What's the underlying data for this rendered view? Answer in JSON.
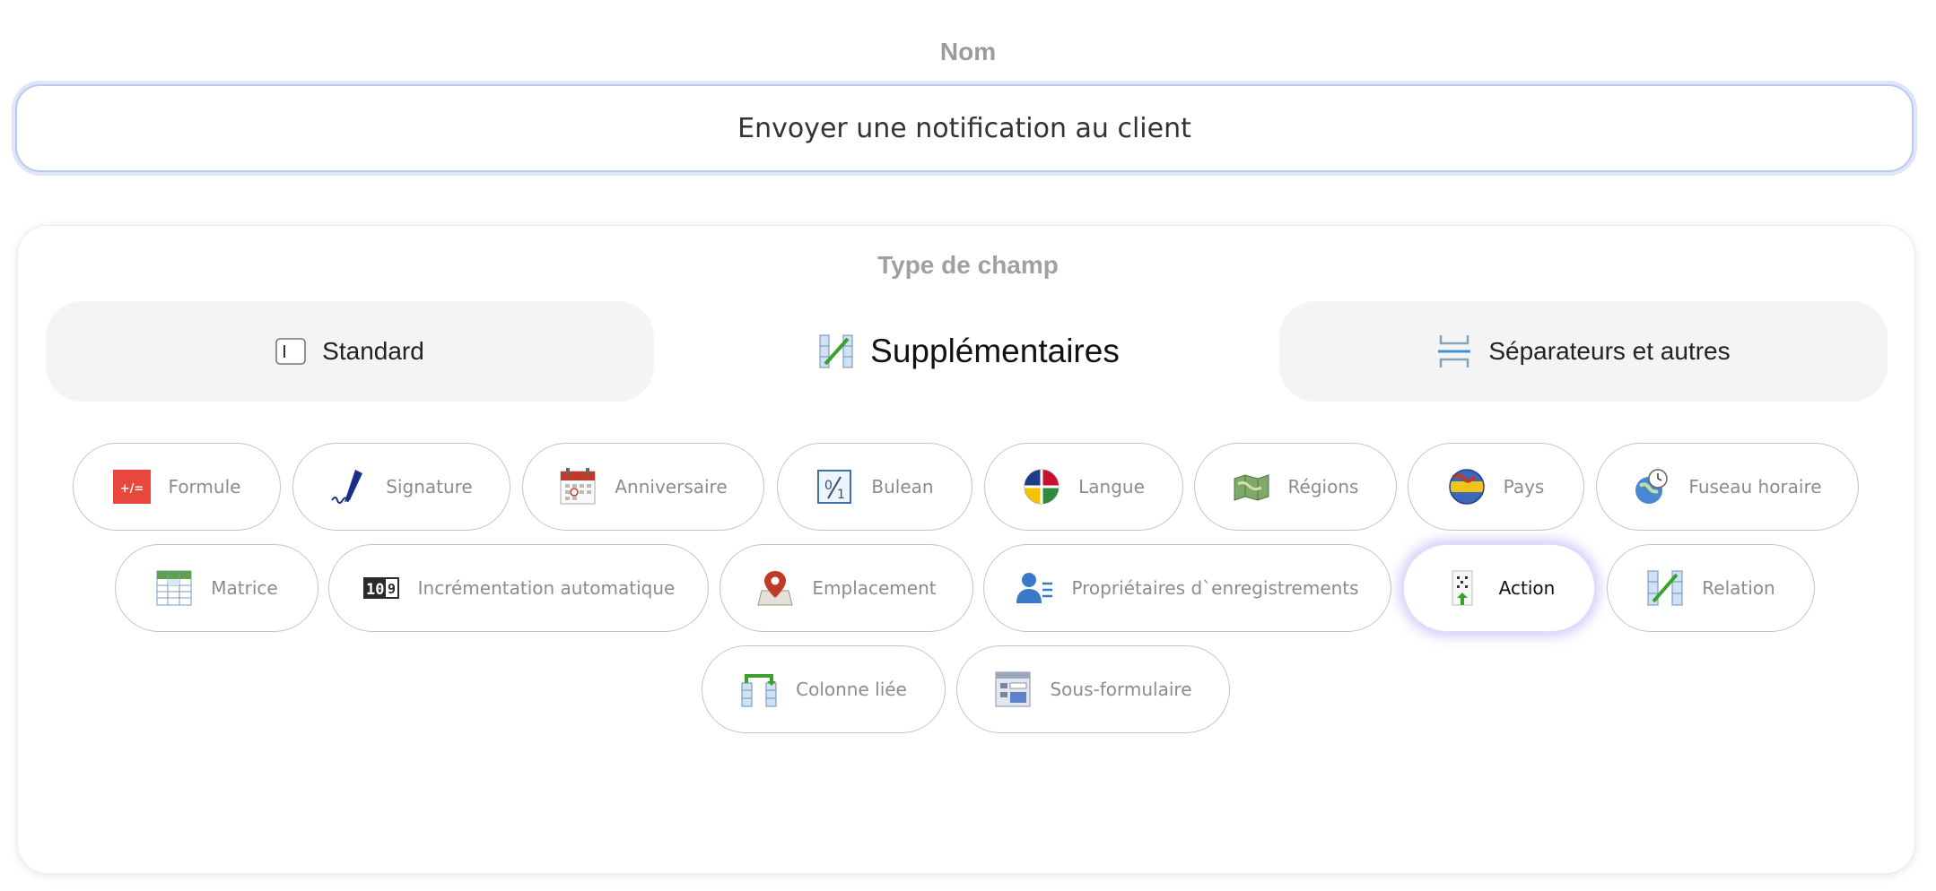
{
  "name_field": {
    "label": "Nom",
    "value": "Envoyer une notification au client"
  },
  "field_type": {
    "title": "Type de champ",
    "tabs": [
      {
        "label": "Standard",
        "icon": "text-field-icon",
        "active": false
      },
      {
        "label": "Supplémentaires",
        "icon": "relation-chart-icon",
        "active": true
      },
      {
        "label": "Séparateurs et autres",
        "icon": "separator-icon",
        "active": false
      }
    ],
    "types": [
      {
        "label": "Formule",
        "icon": "formula-icon"
      },
      {
        "label": "Signature",
        "icon": "signature-pen-icon"
      },
      {
        "label": "Anniversaire",
        "icon": "calendar-icon"
      },
      {
        "label": "Bulean",
        "icon": "boolean-icon"
      },
      {
        "label": "Langue",
        "icon": "language-flags-icon"
      },
      {
        "label": "Régions",
        "icon": "regions-map-icon"
      },
      {
        "label": "Pays",
        "icon": "country-globe-icon"
      },
      {
        "label": "Fuseau horaire",
        "icon": "timezone-globe-icon"
      },
      {
        "label": "Matrice",
        "icon": "matrix-table-icon"
      },
      {
        "label": "Incrémentation automatique",
        "icon": "counter-icon"
      },
      {
        "label": "Emplacement",
        "icon": "location-pin-icon"
      },
      {
        "label": "Propriétaires d`enregistrements",
        "icon": "owner-user-icon"
      },
      {
        "label": "Action",
        "icon": "action-icon",
        "selected": true
      },
      {
        "label": "Relation",
        "icon": "relation-icon"
      },
      {
        "label": "Colonne liée",
        "icon": "linked-column-icon"
      },
      {
        "label": "Sous-formulaire",
        "icon": "subform-icon"
      }
    ]
  },
  "colors": {
    "input_border": "#bcc8f0",
    "selected_glow": "#786eeb",
    "formula_red": "#e8473d"
  }
}
